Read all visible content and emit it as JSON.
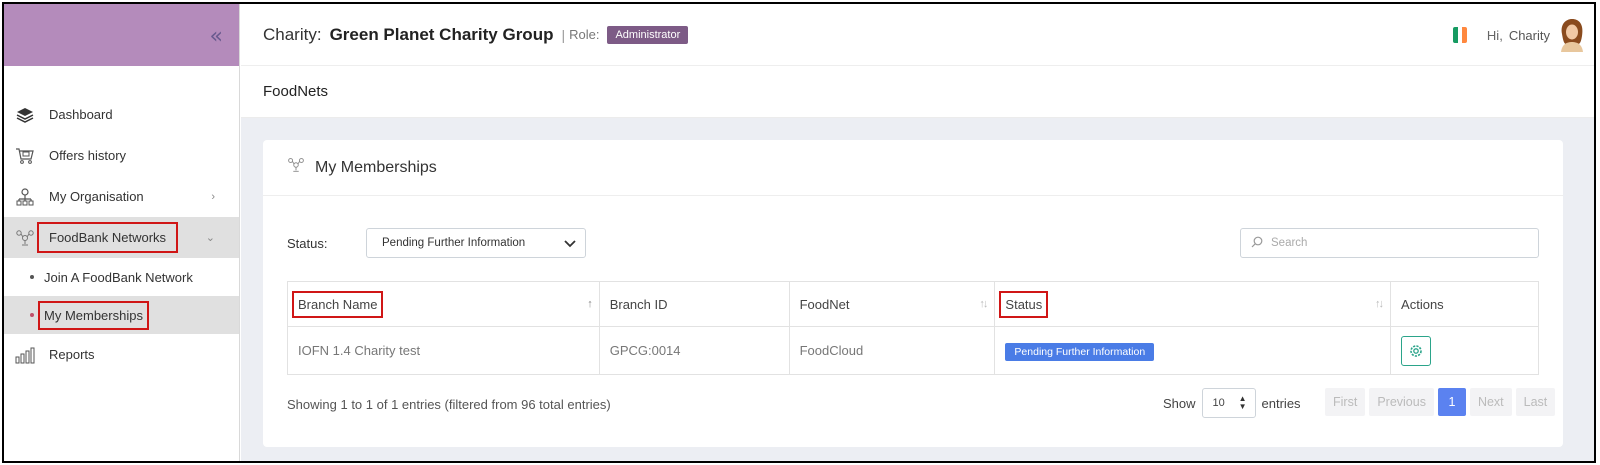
{
  "sidebar": {
    "collapse_glyph": "«",
    "items": [
      {
        "label": "Dashboard"
      },
      {
        "label": "Offers history"
      },
      {
        "label": "My Organisation"
      },
      {
        "label": "FoodBank Networks"
      },
      {
        "label": "Join A FoodBank Network"
      },
      {
        "label": "My Memberships"
      },
      {
        "label": "Reports"
      }
    ]
  },
  "header": {
    "charity_label": "Charity:",
    "charity_name": "Green Planet Charity Group",
    "separator": "|",
    "role_label": "Role:",
    "role_value": "Administrator",
    "greeting": "Hi,",
    "user_name": "Charity"
  },
  "page": {
    "heading": "FoodNets"
  },
  "card": {
    "title": "My Memberships",
    "status_label": "Status:",
    "status_selected": "Pending Further Information",
    "search_placeholder": "Search",
    "columns": [
      "Branch Name",
      "Branch ID",
      "FoodNet",
      "Status",
      "Actions"
    ],
    "rows": [
      {
        "branch_name": "IOFN 1.4 Charity test",
        "branch_id": "GPCG:0014",
        "foodnet": "FoodCloud",
        "status": "Pending Further Information"
      }
    ],
    "info": "Showing 1 to 1 of 1 entries (filtered from 96 total entries)",
    "show_label": "Show",
    "page_length": "10",
    "entries_label": "entries",
    "pager": {
      "first": "First",
      "previous": "Previous",
      "current": "1",
      "next": "Next",
      "last": "Last"
    }
  },
  "colors": {
    "sidebar_header": "#b48bbb",
    "role_badge": "#7d5b86",
    "status_pill": "#4a7ce6",
    "action_border": "#2ba48a",
    "pager_active": "#5b82f0",
    "highlight_box": "#d01616"
  }
}
